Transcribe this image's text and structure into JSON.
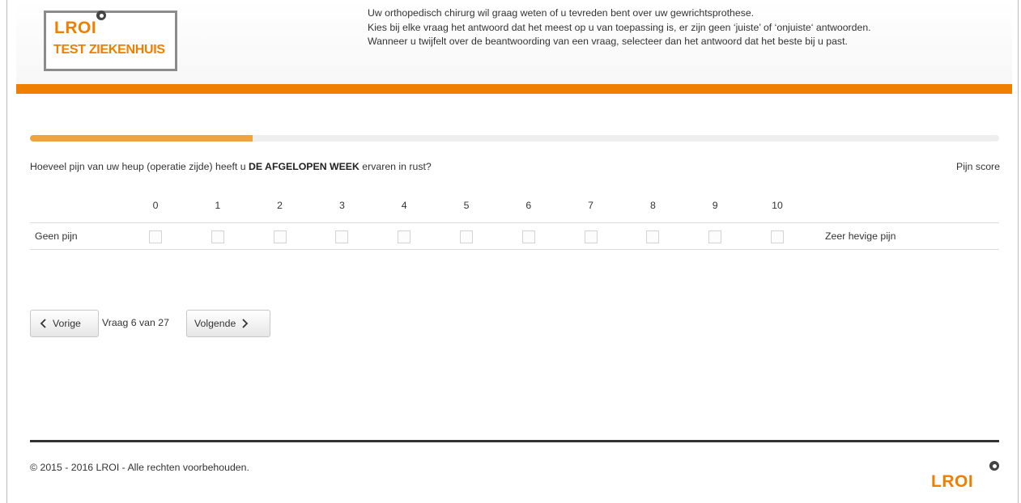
{
  "header": {
    "logo_text": "LROI",
    "hospital_name": "TEST ZIEKENHUIS",
    "intro_lines": [
      "Uw orthopedisch chirurg wil graag weten of u tevreden bent over uw gewrichtsprothese.",
      "Kies bij elke vraag het antwoord dat het meest op u van toepassing is, er zijn geen ‘juiste’ of ‘onjuiste‘ antwoorden.",
      "Wanneer u twijfelt over de beantwoording van een vraag, selecteer dan het antwoord dat het beste bij u past."
    ]
  },
  "colors": {
    "brand_orange": "#ee7f00",
    "progress_fill": "#f0a33c"
  },
  "progress": {
    "fraction": 0.23
  },
  "question": {
    "text_before": "Hoeveel pijn van uw heup (operatie zijde) heeft u ",
    "text_bold": "DE AFGELOPEN WEEK",
    "text_after": " ervaren in rust?",
    "score_label": "Pijn score"
  },
  "scale": {
    "values": [
      "0",
      "1",
      "2",
      "3",
      "4",
      "5",
      "6",
      "7",
      "8",
      "9",
      "10"
    ],
    "left_label": "Geen pijn",
    "right_label": "Zeer hevige pijn",
    "selected": null
  },
  "navigation": {
    "prev_label": "Vorige",
    "next_label": "Volgende",
    "counter": "Vraag 6 van 27",
    "prev_icon": "chevron-left-icon",
    "next_icon": "chevron-right-icon"
  },
  "footer": {
    "copyright": "© 2015 - 2016 LROI - Alle rechten voorbehouden.",
    "logo_text": "LROI"
  }
}
